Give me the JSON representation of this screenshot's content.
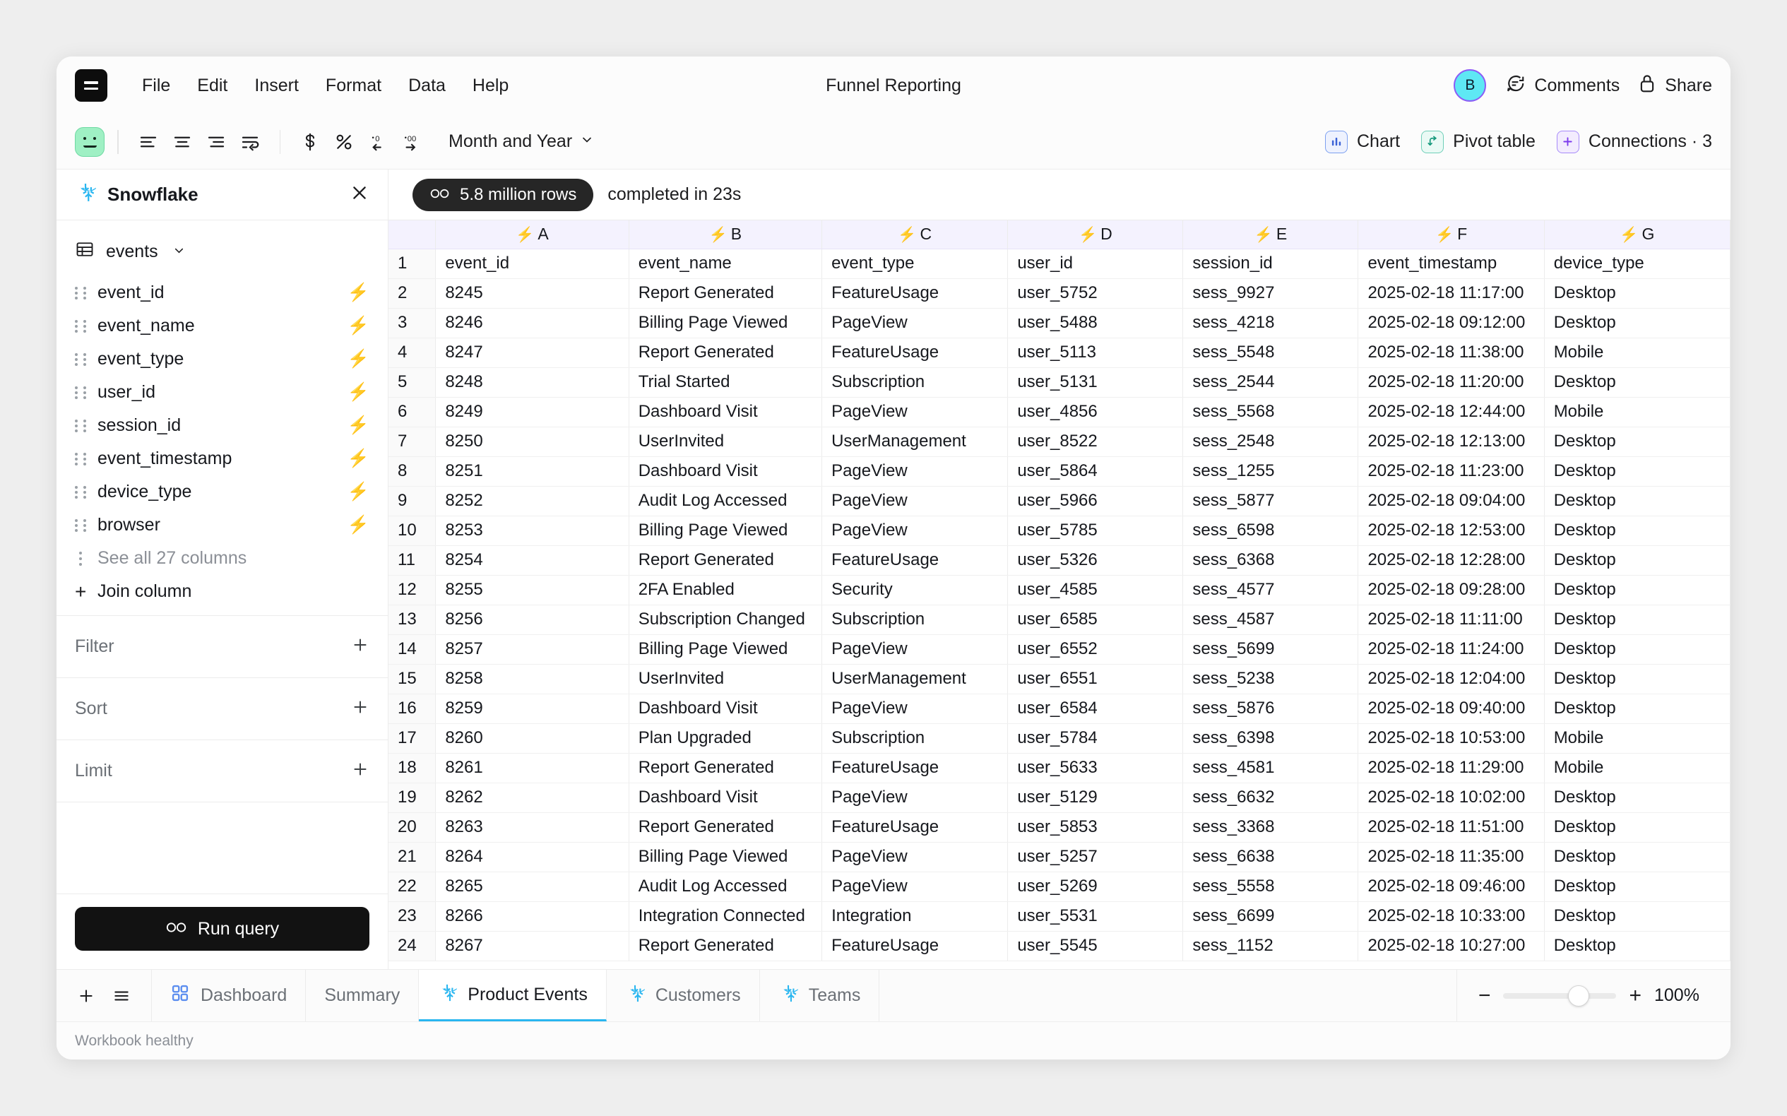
{
  "menubar": {
    "logo_icon": "hamburger-logo-icon",
    "items": [
      "File",
      "Edit",
      "Insert",
      "Format",
      "Data",
      "Help"
    ],
    "doc_title": "Funnel Reporting",
    "avatar_initial": "B",
    "comments_label": "Comments",
    "share_label": "Share"
  },
  "toolbar": {
    "format_selector": "Month and Year",
    "align_icons": [
      "align-left-icon",
      "align-center-icon",
      "align-right-icon",
      "wrap-text-icon"
    ],
    "number_icons": [
      "currency-dollar-icon",
      "percent-icon",
      "decrease-decimal-icon",
      "increase-decimal-icon"
    ],
    "chart_label": "Chart",
    "pivot_label": "Pivot table",
    "connections_label": "Connections · 3"
  },
  "sidebar": {
    "source_title": "Snowflake",
    "table_name": "events",
    "columns": [
      "event_id",
      "event_name",
      "event_type",
      "user_id",
      "session_id",
      "event_timestamp",
      "device_type",
      "browser"
    ],
    "see_all_label": "See all 27 columns",
    "join_label": "Join column",
    "sections": [
      "Filter",
      "Sort",
      "Limit"
    ],
    "run_label": "Run query",
    "bolt_color": "#7c3aed",
    "snowflake_color": "#29b6f0"
  },
  "status": {
    "rows_label": "5.8 million rows",
    "completed_label": "completed in 23s"
  },
  "grid": {
    "column_letters": [
      "A",
      "B",
      "C",
      "D",
      "E",
      "F",
      "G"
    ],
    "header_row_number": "1",
    "headers": [
      "event_id",
      "event_name",
      "event_type",
      "user_id",
      "session_id",
      "event_timestamp",
      "device_type"
    ],
    "rows": [
      {
        "n": "2",
        "cells": [
          "8245",
          "Report Generated",
          "FeatureUsage",
          "user_5752",
          "sess_9927",
          "2025-02-18 11:17:00",
          "Desktop"
        ]
      },
      {
        "n": "3",
        "cells": [
          "8246",
          "Billing Page Viewed",
          "PageView",
          "user_5488",
          "sess_4218",
          "2025-02-18 09:12:00",
          "Desktop"
        ]
      },
      {
        "n": "4",
        "cells": [
          "8247",
          "Report Generated",
          "FeatureUsage",
          "user_5113",
          "sess_5548",
          "2025-02-18 11:38:00",
          "Mobile"
        ]
      },
      {
        "n": "5",
        "cells": [
          "8248",
          "Trial Started",
          "Subscription",
          "user_5131",
          "sess_2544",
          "2025-02-18 11:20:00",
          "Desktop"
        ]
      },
      {
        "n": "6",
        "cells": [
          "8249",
          "Dashboard Visit",
          "PageView",
          "user_4856",
          "sess_5568",
          "2025-02-18 12:44:00",
          "Mobile"
        ]
      },
      {
        "n": "7",
        "cells": [
          "8250",
          "UserInvited",
          "UserManagement",
          "user_8522",
          "sess_2548",
          "2025-02-18 12:13:00",
          "Desktop"
        ]
      },
      {
        "n": "8",
        "cells": [
          "8251",
          "Dashboard Visit",
          "PageView",
          "user_5864",
          "sess_1255",
          "2025-02-18 11:23:00",
          "Desktop"
        ]
      },
      {
        "n": "9",
        "cells": [
          "8252",
          "Audit Log Accessed",
          "PageView",
          "user_5966",
          "sess_5877",
          "2025-02-18 09:04:00",
          "Desktop"
        ]
      },
      {
        "n": "10",
        "cells": [
          "8253",
          "Billing Page Viewed",
          "PageView",
          "user_5785",
          "sess_6598",
          "2025-02-18 12:53:00",
          "Desktop"
        ]
      },
      {
        "n": "11",
        "cells": [
          "8254",
          "Report Generated",
          "FeatureUsage",
          "user_5326",
          "sess_6368",
          "2025-02-18 12:28:00",
          "Desktop"
        ]
      },
      {
        "n": "12",
        "cells": [
          "8255",
          "2FA Enabled",
          "Security",
          "user_4585",
          "sess_4577",
          "2025-02-18 09:28:00",
          "Desktop"
        ]
      },
      {
        "n": "13",
        "cells": [
          "8256",
          "Subscription Changed",
          "Subscription",
          "user_6585",
          "sess_4587",
          "2025-02-18 11:11:00",
          "Desktop"
        ]
      },
      {
        "n": "14",
        "cells": [
          "8257",
          "Billing Page Viewed",
          "PageView",
          "user_6552",
          "sess_5699",
          "2025-02-18 11:24:00",
          "Desktop"
        ]
      },
      {
        "n": "15",
        "cells": [
          "8258",
          "UserInvited",
          "UserManagement",
          "user_6551",
          "sess_5238",
          "2025-02-18 12:04:00",
          "Desktop"
        ]
      },
      {
        "n": "16",
        "cells": [
          "8259",
          "Dashboard Visit",
          "PageView",
          "user_6584",
          "sess_5876",
          "2025-02-18 09:40:00",
          "Desktop"
        ]
      },
      {
        "n": "17",
        "cells": [
          "8260",
          "Plan Upgraded",
          "Subscription",
          "user_5784",
          "sess_6398",
          "2025-02-18 10:53:00",
          "Mobile"
        ]
      },
      {
        "n": "18",
        "cells": [
          "8261",
          "Report Generated",
          "FeatureUsage",
          "user_5633",
          "sess_4581",
          "2025-02-18 11:29:00",
          "Mobile"
        ]
      },
      {
        "n": "19",
        "cells": [
          "8262",
          "Dashboard Visit",
          "PageView",
          "user_5129",
          "sess_6632",
          "2025-02-18 10:02:00",
          "Desktop"
        ]
      },
      {
        "n": "20",
        "cells": [
          "8263",
          "Report Generated",
          "FeatureUsage",
          "user_5853",
          "sess_3368",
          "2025-02-18 11:51:00",
          "Desktop"
        ]
      },
      {
        "n": "21",
        "cells": [
          "8264",
          "Billing Page Viewed",
          "PageView",
          "user_5257",
          "sess_6638",
          "2025-02-18 11:35:00",
          "Desktop"
        ]
      },
      {
        "n": "22",
        "cells": [
          "8265",
          "Audit Log Accessed",
          "PageView",
          "user_5269",
          "sess_5558",
          "2025-02-18 09:46:00",
          "Desktop"
        ]
      },
      {
        "n": "23",
        "cells": [
          "8266",
          "Integration Connected",
          "Integration",
          "user_5531",
          "sess_6699",
          "2025-02-18 10:33:00",
          "Desktop"
        ]
      },
      {
        "n": "24",
        "cells": [
          "8267",
          "Report Generated",
          "FeatureUsage",
          "user_5545",
          "sess_1152",
          "2025-02-18 10:27:00",
          "Desktop"
        ]
      }
    ]
  },
  "tabbar": {
    "add_icon": "plus-icon",
    "list_icon": "list-icon",
    "tabs": [
      {
        "label": "Dashboard",
        "icon": "grid-squares-icon",
        "active": false
      },
      {
        "label": "Summary",
        "icon": "",
        "active": false
      },
      {
        "label": "Product Events",
        "icon": "snowflake-icon",
        "active": true
      },
      {
        "label": "Customers",
        "icon": "snowflake-icon",
        "active": false
      },
      {
        "label": "Teams",
        "icon": "snowflake-icon",
        "active": false
      }
    ],
    "zoom_minus": "−",
    "zoom_plus": "+",
    "zoom_value": "100%"
  },
  "footer": {
    "status": "Workbook healthy"
  }
}
